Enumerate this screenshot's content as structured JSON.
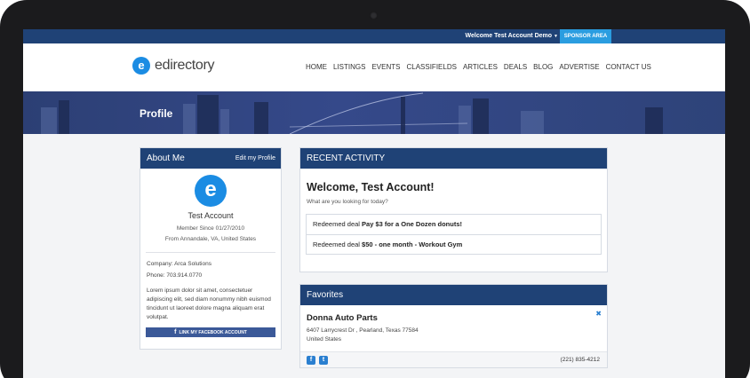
{
  "topbar": {
    "welcome": "Welcome Test Account Demo",
    "sponsor_area": "SPONSOR AREA"
  },
  "logo": {
    "mark": "e",
    "text": "edirectory"
  },
  "nav": {
    "items": [
      "HOME",
      "LISTINGS",
      "EVENTS",
      "CLASSIFIELDS",
      "ARTICLES",
      "DEALS",
      "BLOG",
      "ADVERTISE",
      "CONTACT US"
    ]
  },
  "hero": {
    "title": "Profile"
  },
  "about": {
    "title": "About Me",
    "edit_link": "Edit my Profile",
    "avatar_letter": "e",
    "name": "Test Account",
    "member_since": "Member Since 01/27/2010",
    "location": "From Annandale, VA, United States",
    "company": "Company: Arca Solutions",
    "phone": "Phone: 703.914.0770",
    "bio": "Lorem ipsum dolor sit amet, consectetuer adipiscing elit, sed diam nonummy nibh euismod tincidunt ut laoreet dolore magna aliquam erat volutpat.",
    "facebook_button": "LINK MY FACEBOOK ACCOUNT"
  },
  "activity": {
    "title": "RECENT ACTIVITY",
    "headline": "Welcome, Test Account!",
    "subtitle": "What are you looking for today?",
    "deals": [
      {
        "prefix": "Redeemed deal ",
        "name": "Pay $3 for a One Dozen donuts!"
      },
      {
        "prefix": "Redeemed deal ",
        "name": "$50 - one month - Workout Gym"
      }
    ]
  },
  "favorites": {
    "title": "Favorites",
    "business_name": "Donna Auto Parts",
    "address_line1": "6407 Larrycrest Dr , Pearland, Texas 77584",
    "address_line2": "United States",
    "phone": "(221) 835-4212",
    "close_glyph": "✖"
  },
  "colors": {
    "brand_navy": "#1f4276",
    "accent_blue": "#2a9de0",
    "logo_blue": "#1b8ce3",
    "facebook_blue": "#3b5998"
  },
  "icons": [
    "logo-icon",
    "avatar-icon",
    "facebook-icon",
    "close-icon",
    "twitter-icon"
  ]
}
